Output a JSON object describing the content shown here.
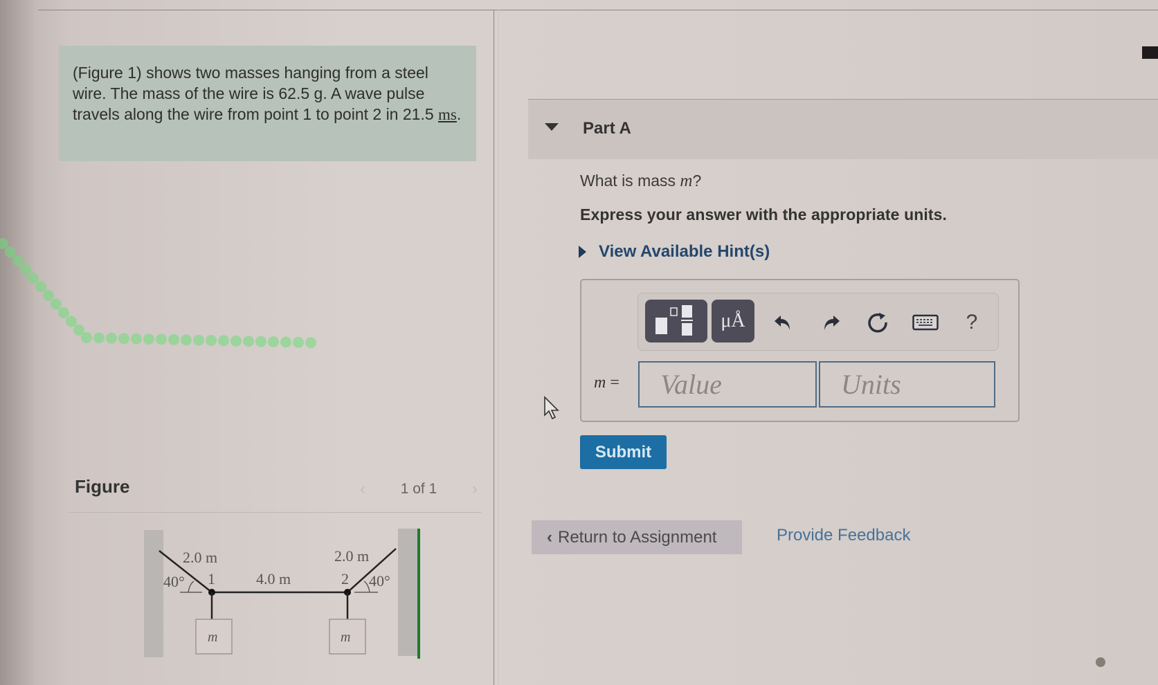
{
  "problem": {
    "intro_prefix": "(Figure 1) shows two masses hanging from a steel wire. The mass of the wire is 62.5 g. A wave pulse travels along the wire from point 1 to point 2 in 21.5 ",
    "intro_unit": "ms",
    "intro_suffix": "."
  },
  "figure": {
    "label": "Figure",
    "pager_text": "1 of 1",
    "prev_icon": "chevron-left-icon",
    "next_icon": "chevron-right-icon",
    "diagram": {
      "left_segment_length": "2.0 m",
      "right_segment_length": "2.0 m",
      "middle_segment_length": "4.0 m",
      "left_angle": "40°",
      "right_angle": "40°",
      "point_1": "1",
      "point_2": "2",
      "left_mass": "m",
      "right_mass": "m"
    }
  },
  "part": {
    "caret_icon": "caret-down-icon",
    "title": "Part A",
    "question_prefix": "What is mass ",
    "question_var": "m",
    "question_suffix": "?",
    "instruction": "Express your answer with the appropriate units.",
    "hint_label": "View Available Hint(s)"
  },
  "toolbar": {
    "templates_icon": "templates-icon",
    "units_label": "μÅ",
    "undo_icon": "undo-icon",
    "redo_icon": "redo-icon",
    "reset_icon": "reset-icon",
    "keyboard_icon": "keyboard-icon",
    "help_label": "?"
  },
  "answer": {
    "variable_label": "m",
    "equals": " =",
    "value_placeholder": "Value",
    "value": "",
    "units_placeholder": "Units",
    "units": ""
  },
  "actions": {
    "submit_label": "Submit",
    "return_label": "Return to Assignment",
    "feedback_label": "Provide Feedback"
  },
  "colors": {
    "intro_bg": "#b7c2ba",
    "submit_bg": "#1c6ea4",
    "link": "#47729a",
    "hint": "#24476e"
  }
}
